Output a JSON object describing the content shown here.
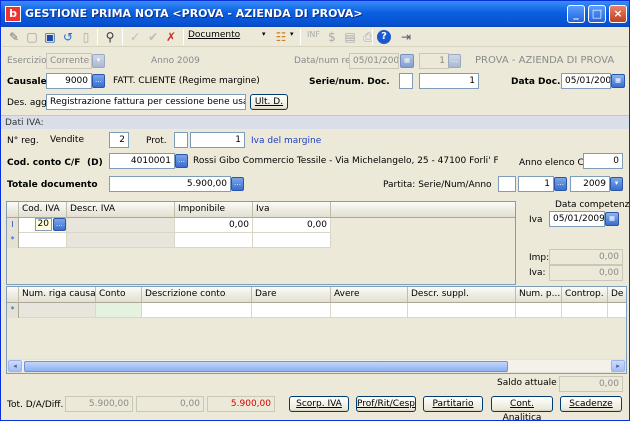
{
  "window": {
    "title": "GESTIONE PRIMA NOTA <PROVA - AZIENDA DI PROVA>",
    "app_icon": "b",
    "min_icon": "_",
    "max_icon": "□",
    "close_icon": "×"
  },
  "toolbar": {
    "documento_label": "Documento",
    "inf_label": "INF"
  },
  "header": {
    "esercizio_label": "Esercizio",
    "esercizio_value": "Corrente",
    "anno_label": "Anno 2009",
    "data_num_reg_label": "Data/num reg.",
    "data_reg_value": "05/01/2009",
    "num_reg_value": "1",
    "azienda_name": "PROVA - AZIENDA DI PROVA",
    "causale_label": "Causale",
    "causale_code": "9000",
    "causale_desc": "FATT. CLIENTE (Regime margine)",
    "serie_num_doc_label": "Serie/num. Doc.",
    "serie_doc_value": "",
    "num_doc_value": "1",
    "data_doc_label": "Data Doc.",
    "data_doc_value": "05/01/2009",
    "des_agg_label": "Des. agg.",
    "des_agg_value": "Registrazione fattura per cessione bene usato",
    "ult_d_button": "Ult. D."
  },
  "iva": {
    "section_label": "Dati IVA:",
    "n_reg_label": "N° reg.",
    "registro_value": "Vendite",
    "registro_num": "2",
    "prot_label": "Prot.",
    "prot_serie": "",
    "prot_value": "1",
    "iva_margine_label": "Iva del margine",
    "cod_conto_label": "Cod. conto C/F",
    "dare_avere_flag": "(D)",
    "conto_code": "4010001",
    "conto_desc": "Rossi Gibo Commercio Tessile  - Via Michelangelo, 25 - 47100 Forli'  FO -",
    "anno_elenco_label": "Anno elenco CF",
    "anno_elenco_value": "0",
    "totale_label": "Totale documento",
    "totale_value": "5.900,00",
    "partita_label": "Partita: Serie/Num/Anno",
    "partita_serie": "",
    "partita_num": "1",
    "partita_anno": "2009",
    "data_competenza_label": "Data competenza",
    "iva_label": "Iva",
    "iva_competenza": "05/01/2009",
    "imp_label": "Imp:",
    "imp_value": "0,00",
    "iva_tot_label": "Iva:",
    "iva_tot_value": "0,00"
  },
  "iva_grid": {
    "columns": [
      "Cod. IVA",
      "Descr. IVA",
      "Imponibile",
      "Iva"
    ],
    "rows": [
      {
        "marker": "I",
        "cod": "20",
        "descr": "",
        "imponibile": "0,00",
        "iva": "0,00"
      }
    ],
    "new_marker": "*"
  },
  "conti_grid": {
    "columns": [
      "Num. riga causale",
      "Conto",
      "Descrizione conto",
      "Dare",
      "Avere",
      "Descr. suppl.",
      "Num. p...",
      "Controp.",
      "De"
    ],
    "new_marker": "*"
  },
  "footer": {
    "saldo_label": "Saldo attuale",
    "saldo_value": "0,00",
    "tot_label": "Tot. D/A/Diff.",
    "tot_dare": "5.900,00",
    "tot_avere": "0,00",
    "tot_diff": "5.900,00",
    "buttons": [
      "Scorp. IVA",
      "Prof/Rit/Cesp",
      "Partitario",
      "Cont. Analitica",
      "Scadenze"
    ]
  },
  "colors": {
    "title_blue": "#0a5fe0",
    "accent_red": "#e00000",
    "link_blue": "#2040c0"
  }
}
